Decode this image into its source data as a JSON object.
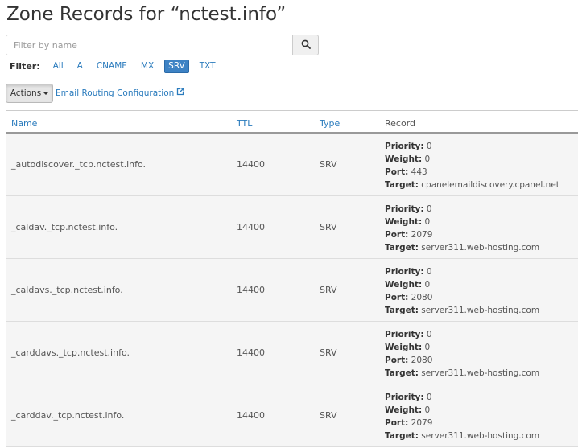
{
  "title": "Zone Records for “nctest.info”",
  "search": {
    "placeholder": "Filter by name",
    "value": ""
  },
  "filter": {
    "label": "Filter:",
    "options": [
      "All",
      "A",
      "CNAME",
      "MX",
      "SRV",
      "TXT"
    ],
    "active": "SRV"
  },
  "actions_label": "Actions",
  "email_routing_label": "Email Routing Configuration",
  "columns": {
    "name": "Name",
    "ttl": "TTL",
    "type": "Type",
    "record": "Record"
  },
  "record_labels": {
    "priority": "Priority:",
    "weight": "Weight:",
    "port": "Port:",
    "target": "Target:"
  },
  "rows": [
    {
      "name": "_autodiscover._tcp.nctest.info.",
      "ttl": "14400",
      "type": "SRV",
      "priority": "0",
      "weight": "0",
      "port": "443",
      "target": "cpanelemaildiscovery.cpanel.net"
    },
    {
      "name": "_caldav._tcp.nctest.info.",
      "ttl": "14400",
      "type": "SRV",
      "priority": "0",
      "weight": "0",
      "port": "2079",
      "target": "server311.web-hosting.com"
    },
    {
      "name": "_caldavs._tcp.nctest.info.",
      "ttl": "14400",
      "type": "SRV",
      "priority": "0",
      "weight": "0",
      "port": "2080",
      "target": "server311.web-hosting.com"
    },
    {
      "name": "_carddavs._tcp.nctest.info.",
      "ttl": "14400",
      "type": "SRV",
      "priority": "0",
      "weight": "0",
      "port": "2080",
      "target": "server311.web-hosting.com"
    },
    {
      "name": "_carddav._tcp.nctest.info.",
      "ttl": "14400",
      "type": "SRV",
      "priority": "0",
      "weight": "0",
      "port": "2079",
      "target": "server311.web-hosting.com"
    }
  ],
  "colors": {
    "link": "#2a7bbd",
    "active_filter": "#3d82c4",
    "row_bg": "#f5f5f5"
  },
  "icons": {
    "search": "magnifier",
    "external_link": "external-link"
  }
}
